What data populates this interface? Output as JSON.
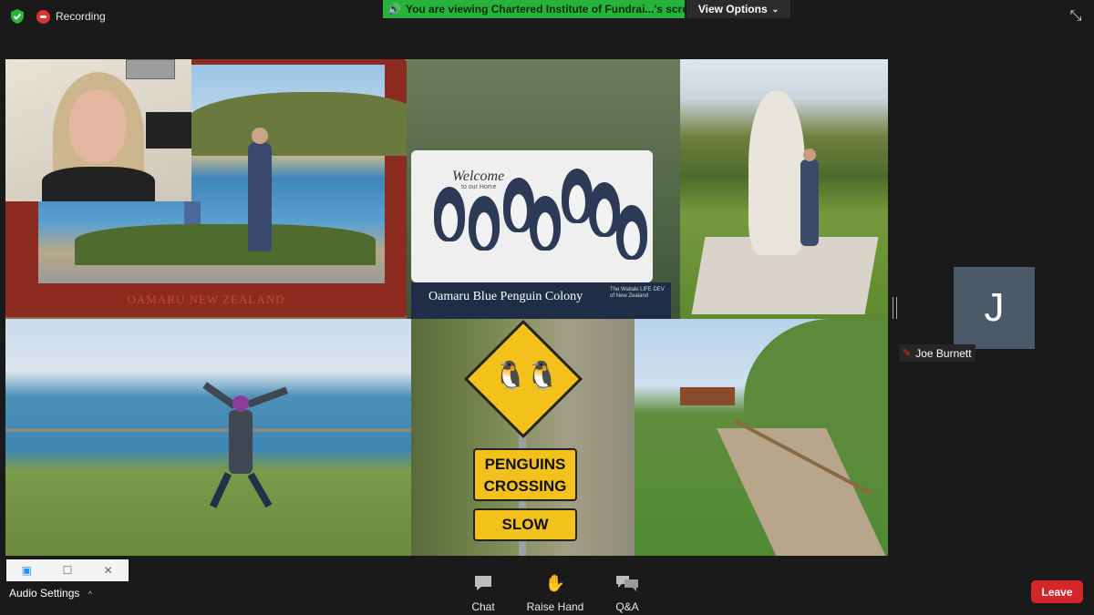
{
  "top_bar": {
    "security_icon": "shield-check-icon",
    "recording_label": "Recording",
    "share_banner": "You are viewing Chartered Institute of Fundrai...'s screen",
    "view_options_label": "View Options",
    "exit_fullscreen_icon": "exit-fullscreen-icon"
  },
  "shared_screen": {
    "frame_caption": "OAMARU  NEW ZEALAND",
    "sign_welcome": "Welcome",
    "sign_to_our_home": "to our Home",
    "sign_colony": "Oamaru Blue Penguin Colony",
    "sign_small": "The Waitaki LIFE DEV of New Zealand",
    "road_sign_line1": "PENGUINS",
    "road_sign_line2": "CROSSING",
    "road_sign_slow": "SLOW"
  },
  "participant": {
    "initial": "J",
    "name": "Joe Burnett",
    "muted": true
  },
  "bottom_bar": {
    "audio_settings_label": "Audio Settings",
    "controls": [
      {
        "label": "Chat",
        "icon": "chat-icon"
      },
      {
        "label": "Raise Hand",
        "icon": "raise-hand-icon"
      },
      {
        "label": "Q&A",
        "icon": "qa-icon"
      }
    ],
    "leave_label": "Leave"
  },
  "colors": {
    "banner_green": "#27b33a",
    "leave_red": "#d4262a",
    "recording_red": "#e0322d",
    "avatar_bg": "#4b5a68"
  }
}
